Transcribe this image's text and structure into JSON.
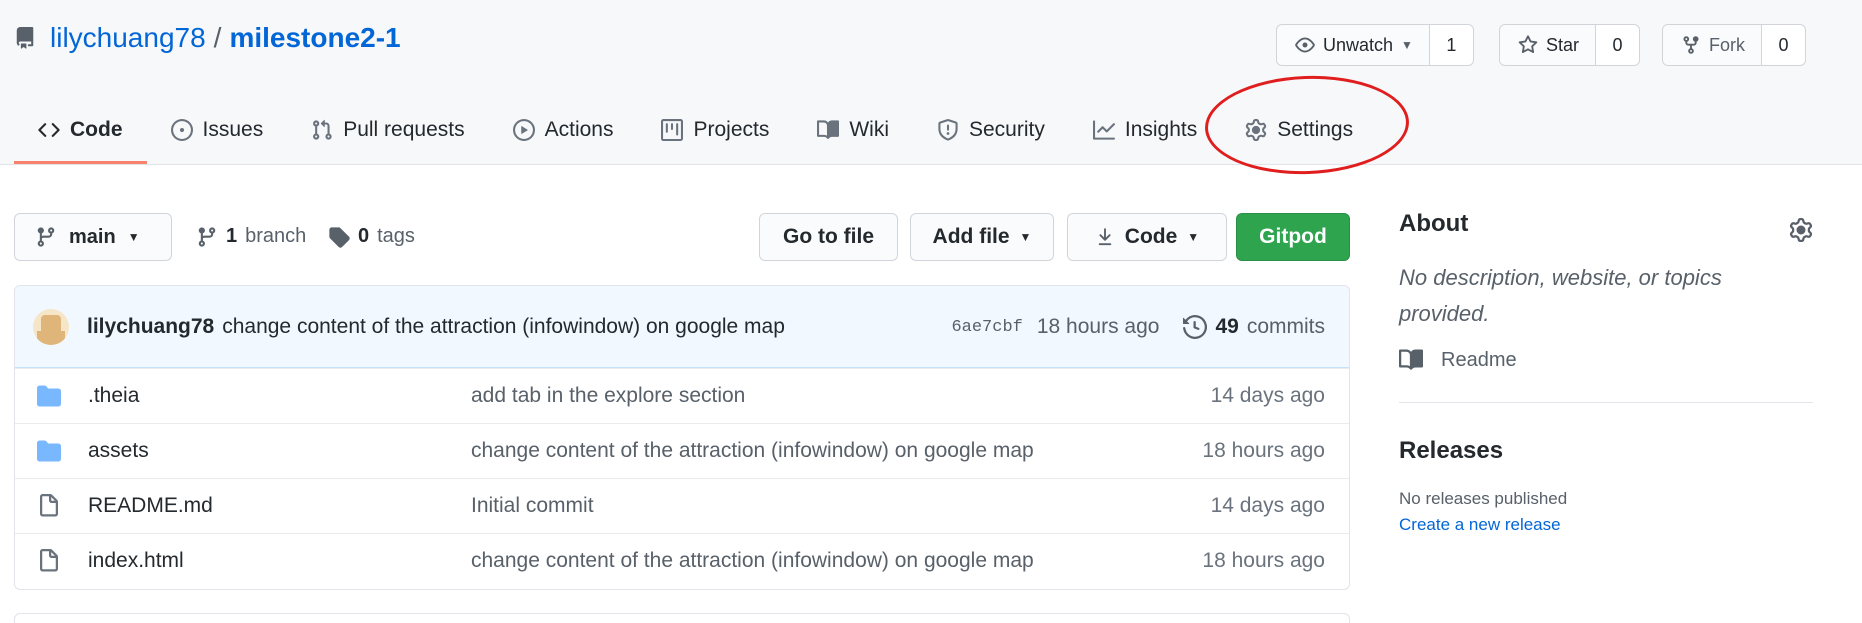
{
  "repo": {
    "owner": "lilychuang78",
    "separator": "/",
    "name": "milestone2-1"
  },
  "actions": {
    "watch": {
      "label": "Unwatch",
      "count": "1"
    },
    "star": {
      "label": "Star",
      "count": "0"
    },
    "fork": {
      "label": "Fork",
      "count": "0"
    }
  },
  "tabs": [
    {
      "label": "Code",
      "icon": "code-icon",
      "active": true
    },
    {
      "label": "Issues",
      "icon": "issue-icon"
    },
    {
      "label": "Pull requests",
      "icon": "pull-request-icon"
    },
    {
      "label": "Actions",
      "icon": "play-icon"
    },
    {
      "label": "Projects",
      "icon": "project-icon"
    },
    {
      "label": "Wiki",
      "icon": "book-icon"
    },
    {
      "label": "Security",
      "icon": "shield-icon"
    },
    {
      "label": "Insights",
      "icon": "graph-icon"
    },
    {
      "label": "Settings",
      "icon": "gear-icon"
    }
  ],
  "toolbar": {
    "branch": "main",
    "branches_count": "1",
    "branches_label": "branch",
    "tags_count": "0",
    "tags_label": "tags",
    "goto_file": "Go to file",
    "add_file": "Add file",
    "code": "Code",
    "gitpod": "Gitpod"
  },
  "latest_commit": {
    "author": "lilychuang78",
    "message": "change content of the attraction (infowindow) on google map",
    "sha": "6ae7cbf",
    "time": "18 hours ago",
    "commits_count": "49",
    "commits_label": "commits"
  },
  "files": [
    {
      "name": ".theia",
      "type": "folder",
      "message": "add tab in the explore section",
      "time": "14 days ago"
    },
    {
      "name": "assets",
      "type": "folder",
      "message": "change content of the attraction (infowindow) on google map",
      "time": "18 hours ago"
    },
    {
      "name": "README.md",
      "type": "file",
      "message": "Initial commit",
      "time": "14 days ago"
    },
    {
      "name": "index.html",
      "type": "file",
      "message": "change content of the attraction (infowindow) on google map",
      "time": "18 hours ago"
    }
  ],
  "about": {
    "title": "About",
    "description": "No description, website, or topics provided.",
    "readme": "Readme"
  },
  "releases": {
    "title": "Releases",
    "none": "No releases published",
    "create": "Create a new release"
  },
  "colors": {
    "link": "#0366d6",
    "gitpod": "#2ea44f",
    "annotation": "#e01e1e",
    "active_tab": "#f9826c"
  }
}
